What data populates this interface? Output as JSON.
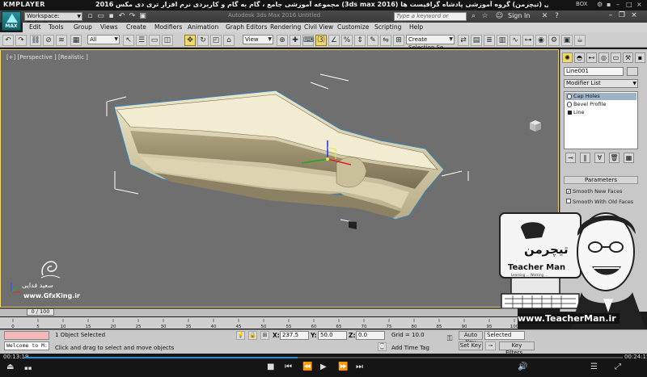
{
  "player": {
    "brand": "KMPLAYER",
    "title": "مجموعه آموزشی جامع ، گام به گام و کاربردی نرم افزار تری دی مکس 2016 (3ds max 2016)   مدرس : سعید فدایی (تیچرمن) گروه آموزشی پادشاه گرافیست ها",
    "box_label": "BOX",
    "time_current": "00:13:19",
    "time_total": "00:24:15",
    "progress_fraction": 0.457
  },
  "app": {
    "logo_text": "MAX",
    "workspace": "Workspace: Default",
    "doc_title": "Autodesk 3ds Max 2016    Untitled",
    "search_placeholder": "Type a keyword or phrase",
    "sign_in": "Sign In"
  },
  "menu": [
    "Edit",
    "Tools",
    "Group",
    "Views",
    "Create",
    "Modifiers",
    "Animation",
    "Graph Editors",
    "Rendering",
    "Civil View",
    "Customize",
    "Scripting",
    "Help"
  ],
  "toolbar": {
    "filter_value": "All",
    "refcoord_value": "View",
    "selection_set_placeholder": "Create Selection Se"
  },
  "viewport": {
    "label": "[+] [Perspective ] [Realistic ]",
    "watermark_name": "سعید فدایی",
    "watermark_site": "www.GfxKing.ir"
  },
  "command_panel": {
    "object_name": "Line001",
    "modifier_list": "Modifier List",
    "stack": [
      {
        "label": "Cap Holes",
        "selected": true
      },
      {
        "label": "Bevel Profile",
        "selected": false
      },
      {
        "label": "Line",
        "selected": false
      }
    ],
    "params_title": "Parameters",
    "params": [
      {
        "label": "Smooth New Faces",
        "checked": true
      },
      {
        "label": "Smooth With Old Faces",
        "checked": false
      }
    ]
  },
  "banner": {
    "site": "www.TeacherMan.ir",
    "logo_fa": "تیچرمن",
    "logo_en": "Teacher Man",
    "tagline": "Learning ... Working ..."
  },
  "timeline": {
    "frame_label": "0 / 100",
    "ticks": [
      "0",
      "5",
      "10",
      "15",
      "20",
      "25",
      "30",
      "35",
      "40",
      "45",
      "50",
      "55",
      "60",
      "65",
      "70",
      "75",
      "80",
      "85",
      "90",
      "95",
      "100"
    ]
  },
  "status": {
    "welcome": "Welcome to M:",
    "selection": "1 Object Selected",
    "prompt": "Click and drag to select and move objects",
    "x_label": "X:",
    "x_value": "237.5",
    "y_label": "Y:",
    "y_value": "50.0",
    "z_label": "Z:",
    "z_value": "0.0",
    "grid": "Grid = 10.0",
    "add_time_tag": "Add Time Tag",
    "auto_key": "Auto Key",
    "set_key": "Set Key",
    "selected_value": "Selected",
    "key_filters": "Key Filters..."
  },
  "colors": {
    "viewport_bg": "#6f6f6f",
    "active_border": "#f3d96b",
    "stack_selected": "#9fb3c8",
    "seek_fill": "#2f8ed8",
    "model_face": "#d8cfae"
  }
}
